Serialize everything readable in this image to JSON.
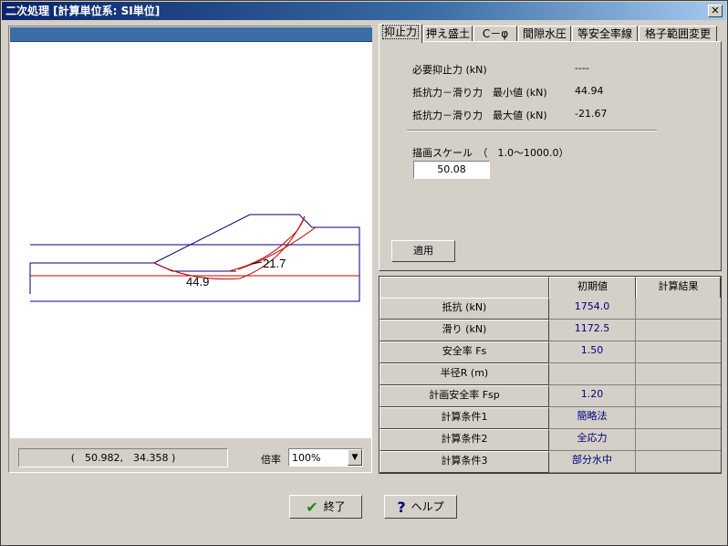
{
  "window": {
    "title": "二次処理 [計算単位系: SI単位]",
    "close_label": "✕"
  },
  "drawing": {
    "label_a": "21.7",
    "label_b": "44.9",
    "coord_readout": "(　50.982,　34.358 )",
    "scale_label": "倍率",
    "scale_value": "100%"
  },
  "tabs": [
    "抑止力",
    "押え盛土",
    "C－φ",
    "間隙水圧",
    "等安全率線",
    "格子範囲変更"
  ],
  "active_tab": "抑止力",
  "panel": {
    "required_label": "必要抑止力 (kN)",
    "required_value": "----",
    "min_label": "抵抗力－滑り力　最小値 (kN)",
    "min_value": "44.94",
    "max_label": "抵抗力－滑り力　最大値 (kN)",
    "max_value": "-21.67",
    "scale_label": "描画スケール　（　1.0～1000.0）",
    "scale_value": "50.08",
    "apply_label": "適用"
  },
  "table": {
    "headers": [
      "",
      "初期値",
      "計算結果"
    ],
    "rows": [
      {
        "label": "抵抗 (kN)",
        "initial": "1754.0",
        "result": ""
      },
      {
        "label": "滑り (kN)",
        "initial": "1172.5",
        "result": ""
      },
      {
        "label": "安全率 Fs",
        "initial": "1.50",
        "result": ""
      },
      {
        "label": "半径R (m)",
        "initial": "",
        "result": ""
      },
      {
        "label": "計画安全率 Fsp",
        "initial": "1.20",
        "result": ""
      },
      {
        "label": "計算条件1",
        "initial": "簡略法",
        "result": ""
      },
      {
        "label": "計算条件2",
        "initial": "全応力",
        "result": ""
      },
      {
        "label": "計算条件3",
        "initial": "部分水中",
        "result": ""
      }
    ]
  },
  "buttons": {
    "ok_label": "終了",
    "help_label": "ヘルプ"
  },
  "colors": {
    "title_bg": "#0a246a",
    "drawing_line": "#00007f",
    "slip_line": "#cc0000"
  }
}
